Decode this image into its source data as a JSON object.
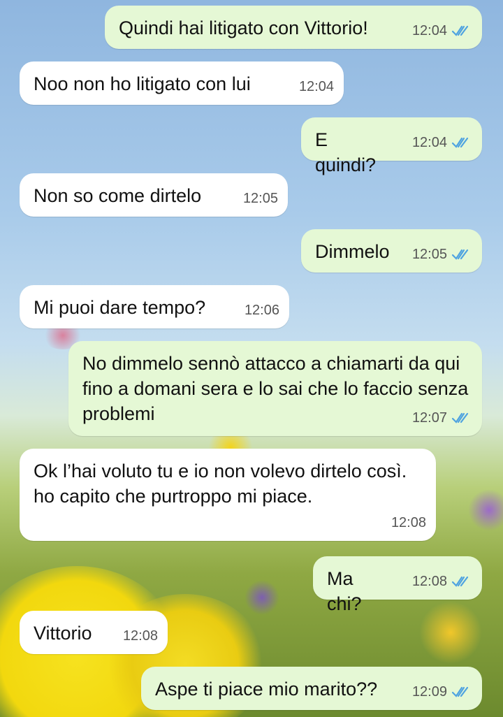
{
  "messages": [
    {
      "dir": "out",
      "text": "Quindi hai litigato con Vittorio!",
      "time": "12:04",
      "read": true
    },
    {
      "dir": "in",
      "text": "Noo non ho litigato con lui",
      "time": "12:04"
    },
    {
      "dir": "out",
      "text": "E quindi?",
      "time": "12:04",
      "read": true
    },
    {
      "dir": "in",
      "text": "Non so come dirtelo",
      "time": "12:05"
    },
    {
      "dir": "out",
      "text": "Dimmelo",
      "time": "12:05",
      "read": true
    },
    {
      "dir": "in",
      "text": "Mi puoi dare tempo?",
      "time": "12:06"
    },
    {
      "dir": "out",
      "text": "No dimmelo sennò attacco a chiamarti da qui fino a domani sera e lo sai che lo faccio senza problemi",
      "time": "12:07",
      "read": true
    },
    {
      "dir": "in",
      "text": "Ok l’hai voluto tu e io non volevo dirtelo così. ho capito che purtroppo mi piace.",
      "time": "12:08"
    },
    {
      "dir": "out",
      "text": "Ma chi?",
      "time": "12:08",
      "read": true
    },
    {
      "dir": "in",
      "text": "Vittorio",
      "time": "12:08"
    },
    {
      "dir": "out",
      "text": "Aspe ti piace mio marito??",
      "time": "12:09",
      "read": true
    }
  ],
  "colors": {
    "outgoing": "#e5f8d5",
    "incoming": "#ffffff",
    "read_ticks": "#4fa3e0"
  },
  "icons": {
    "read_receipt": "double-check-icon"
  }
}
